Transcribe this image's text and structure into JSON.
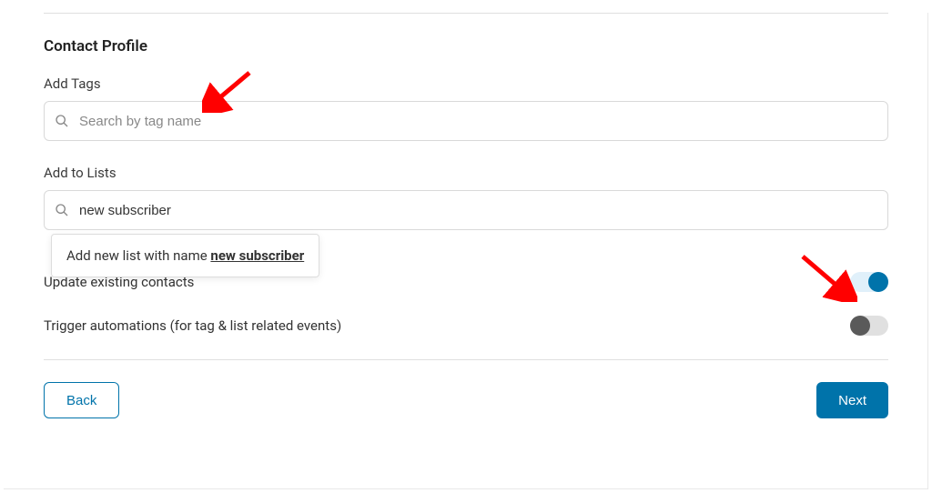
{
  "section": {
    "title": "Contact Profile"
  },
  "tags": {
    "label": "Add Tags",
    "placeholder": "Search by tag name",
    "value": ""
  },
  "lists": {
    "label": "Add to Lists",
    "value": "new subscriber",
    "suggest_prefix": "Add new list with name ",
    "suggest_value": "new subscriber"
  },
  "toggles": {
    "update_existing": {
      "label": "Update existing contacts",
      "on": true
    },
    "trigger_automations": {
      "label": "Trigger automations (for tag & list related events)",
      "on": false
    }
  },
  "buttons": {
    "back": "Back",
    "next": "Next"
  }
}
